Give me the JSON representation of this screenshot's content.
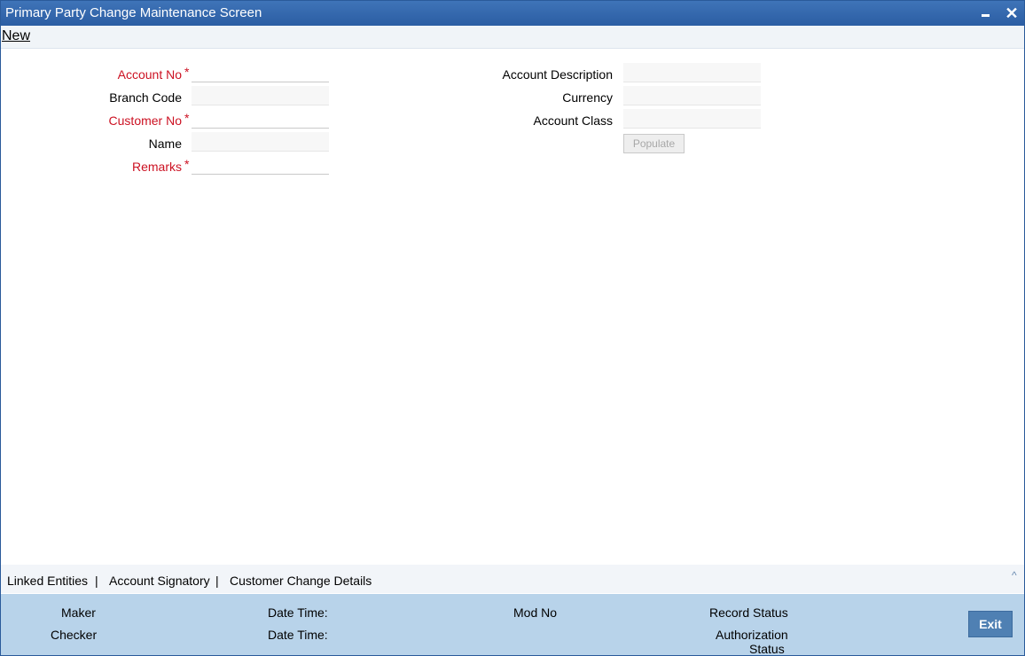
{
  "window": {
    "title": "Primary Party Change Maintenance Screen",
    "minimize_label": "",
    "close_label": "✕"
  },
  "menu": {
    "new_label": "New"
  },
  "form": {
    "account_no": {
      "label": "Account No",
      "required": "*",
      "value": ""
    },
    "branch_code": {
      "label": "Branch Code",
      "value": ""
    },
    "customer_no": {
      "label": "Customer No",
      "required": "*",
      "value": ""
    },
    "name": {
      "label": "Name",
      "value": ""
    },
    "remarks": {
      "label": "Remarks",
      "required": "*",
      "value": ""
    },
    "account_description": {
      "label": "Account Description",
      "value": ""
    },
    "currency": {
      "label": "Currency",
      "value": ""
    },
    "account_class": {
      "label": "Account Class",
      "value": ""
    },
    "populate_label": "Populate"
  },
  "tabs": {
    "linked_entities": "Linked Entities",
    "account_signatory": "Account Signatory",
    "customer_change_details": "Customer Change Details",
    "separator": "|",
    "caret": "^"
  },
  "footer": {
    "maker": "Maker",
    "checker": "Checker",
    "date_time_1": "Date Time:",
    "date_time_2": "Date Time:",
    "mod_no": "Mod No",
    "record_status": "Record Status",
    "authorization": "Authorization",
    "status": "Status",
    "exit_label": "Exit"
  }
}
